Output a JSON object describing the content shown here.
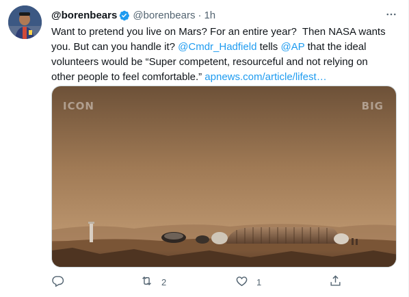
{
  "tweet": {
    "display_name": "@borenbears",
    "handle": "@borenbears",
    "separator": "·",
    "time": "1h",
    "text_part1": "Want to pretend you live on Mars? For an entire year?  Then NASA wants you. But can you handle it? ",
    "mention_1": "@Cmdr_Hadfield",
    "text_part2": " tells ",
    "mention_2": "@AP",
    "text_part3": " that the ideal volunteers would be “Super competent, resourceful and not relying on other people to feel comfortable.” ",
    "url": "apnews.com/article/lifest…",
    "media": {
      "watermark_left": "ICON",
      "watermark_right": "BIG"
    },
    "actions": {
      "reply_count": "",
      "retweet_count": "2",
      "like_count": "1",
      "share_count": ""
    },
    "colors": {
      "link": "#1d9bf0",
      "secondary_text": "#536471",
      "verified": "#1d9bf0"
    },
    "icons": [
      "verified-badge-icon",
      "more-icon",
      "reply-icon",
      "retweet-icon",
      "like-icon",
      "share-icon"
    ]
  }
}
